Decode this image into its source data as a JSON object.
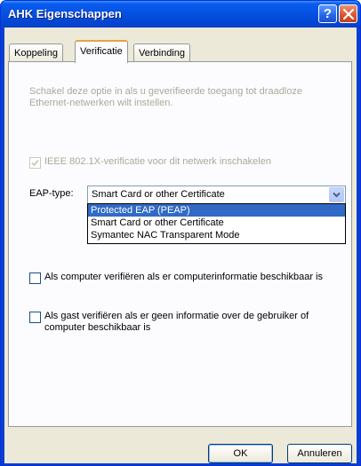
{
  "window": {
    "title": "AHK Eigenschappen"
  },
  "titlebar_buttons": {
    "help": "?"
  },
  "tabs": [
    {
      "label": "Koppeling"
    },
    {
      "label": "Verificatie"
    },
    {
      "label": "Verbinding"
    }
  ],
  "active_tab": "Verificatie",
  "panel": {
    "description": "Schakel deze optie in als u geverifieerde toegang tot draadloze Ethernet-netwerken wilt instellen.",
    "ieee_checkbox": {
      "label": "IEEE 802.1X-verificatie voor dit netwerk inschakelen",
      "checked": true,
      "enabled": false
    },
    "eap": {
      "label": "EAP-type:",
      "value": "Smart Card or other Certificate",
      "options": [
        {
          "label": "Protected EAP (PEAP)",
          "highlighted": true
        },
        {
          "label": "Smart Card or other Certificate",
          "highlighted": false
        },
        {
          "label": "Symantec NAC Transparent Mode",
          "highlighted": false
        }
      ]
    },
    "computer_checkbox": {
      "label": "Als computer verifiëren als er computerinformatie beschikbaar is",
      "checked": false
    },
    "guest_checkbox": {
      "label": "Als gast verifiëren als er geen informatie over de gebruiker of computer beschikbaar is",
      "checked": false
    }
  },
  "buttons": {
    "ok": "OK",
    "cancel": "Annuleren"
  },
  "colors": {
    "titlebar": "#0552e1",
    "highlight": "#316ac5",
    "dialog_bg": "#ece9d8",
    "tab_accent": "#e6a43c"
  }
}
